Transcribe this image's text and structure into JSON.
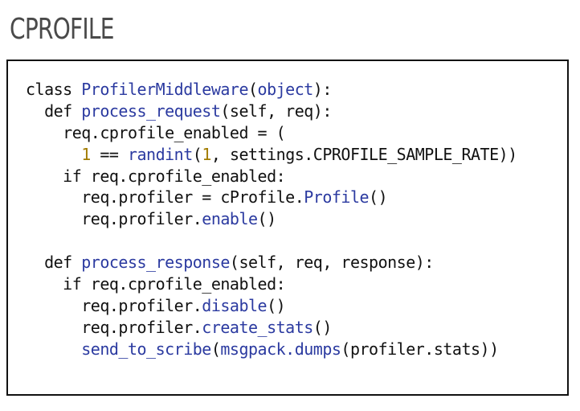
{
  "slide": {
    "title": "CPROFILE"
  },
  "colors": {
    "plain": "#111111",
    "function": "#2b3aa0",
    "number": "#a27c00",
    "title": "#4a4a4a"
  },
  "code": {
    "lines": [
      {
        "indent": "",
        "tokens": [
          {
            "text": "class ",
            "kind": "plain"
          },
          {
            "text": "ProfilerMiddleware",
            "kind": "fn"
          },
          {
            "text": "(",
            "kind": "plain"
          },
          {
            "text": "object",
            "kind": "fn"
          },
          {
            "text": "):",
            "kind": "plain"
          }
        ]
      },
      {
        "indent": "  ",
        "tokens": [
          {
            "text": "def ",
            "kind": "plain"
          },
          {
            "text": "process_request",
            "kind": "fn"
          },
          {
            "text": "(self, req):",
            "kind": "plain"
          }
        ]
      },
      {
        "indent": "    ",
        "tokens": [
          {
            "text": "req.cprofile_enabled = (",
            "kind": "plain"
          }
        ]
      },
      {
        "indent": "      ",
        "tokens": [
          {
            "text": "1",
            "kind": "num"
          },
          {
            "text": " == ",
            "kind": "plain"
          },
          {
            "text": "randint",
            "kind": "fn"
          },
          {
            "text": "(",
            "kind": "plain"
          },
          {
            "text": "1",
            "kind": "num"
          },
          {
            "text": ", settings.CPROFILE_SAMPLE_RATE))",
            "kind": "plain"
          }
        ]
      },
      {
        "indent": "    ",
        "tokens": [
          {
            "text": "if req.cprofile_enabled:",
            "kind": "plain"
          }
        ]
      },
      {
        "indent": "      ",
        "tokens": [
          {
            "text": "req.profiler = cProfile.",
            "kind": "plain"
          },
          {
            "text": "Profile",
            "kind": "fn"
          },
          {
            "text": "()",
            "kind": "plain"
          }
        ]
      },
      {
        "indent": "      ",
        "tokens": [
          {
            "text": "req.profiler.",
            "kind": "plain"
          },
          {
            "text": "enable",
            "kind": "fn"
          },
          {
            "text": "()",
            "kind": "plain"
          }
        ]
      },
      {
        "indent": "",
        "tokens": []
      },
      {
        "indent": "  ",
        "tokens": [
          {
            "text": "def ",
            "kind": "plain"
          },
          {
            "text": "process_response",
            "kind": "fn"
          },
          {
            "text": "(self, req, response):",
            "kind": "plain"
          }
        ]
      },
      {
        "indent": "    ",
        "tokens": [
          {
            "text": "if req.cprofile_enabled:",
            "kind": "plain"
          }
        ]
      },
      {
        "indent": "      ",
        "tokens": [
          {
            "text": "req.profiler.",
            "kind": "plain"
          },
          {
            "text": "disable",
            "kind": "fn"
          },
          {
            "text": "()",
            "kind": "plain"
          }
        ]
      },
      {
        "indent": "      ",
        "tokens": [
          {
            "text": "req.profiler.",
            "kind": "plain"
          },
          {
            "text": "create_stats",
            "kind": "fn"
          },
          {
            "text": "()",
            "kind": "plain"
          }
        ]
      },
      {
        "indent": "      ",
        "tokens": [
          {
            "text": "send_to_scribe",
            "kind": "fn"
          },
          {
            "text": "(",
            "kind": "plain"
          },
          {
            "text": "msgpack.dumps",
            "kind": "fn"
          },
          {
            "text": "(profiler.stats))",
            "kind": "plain"
          }
        ]
      }
    ]
  }
}
